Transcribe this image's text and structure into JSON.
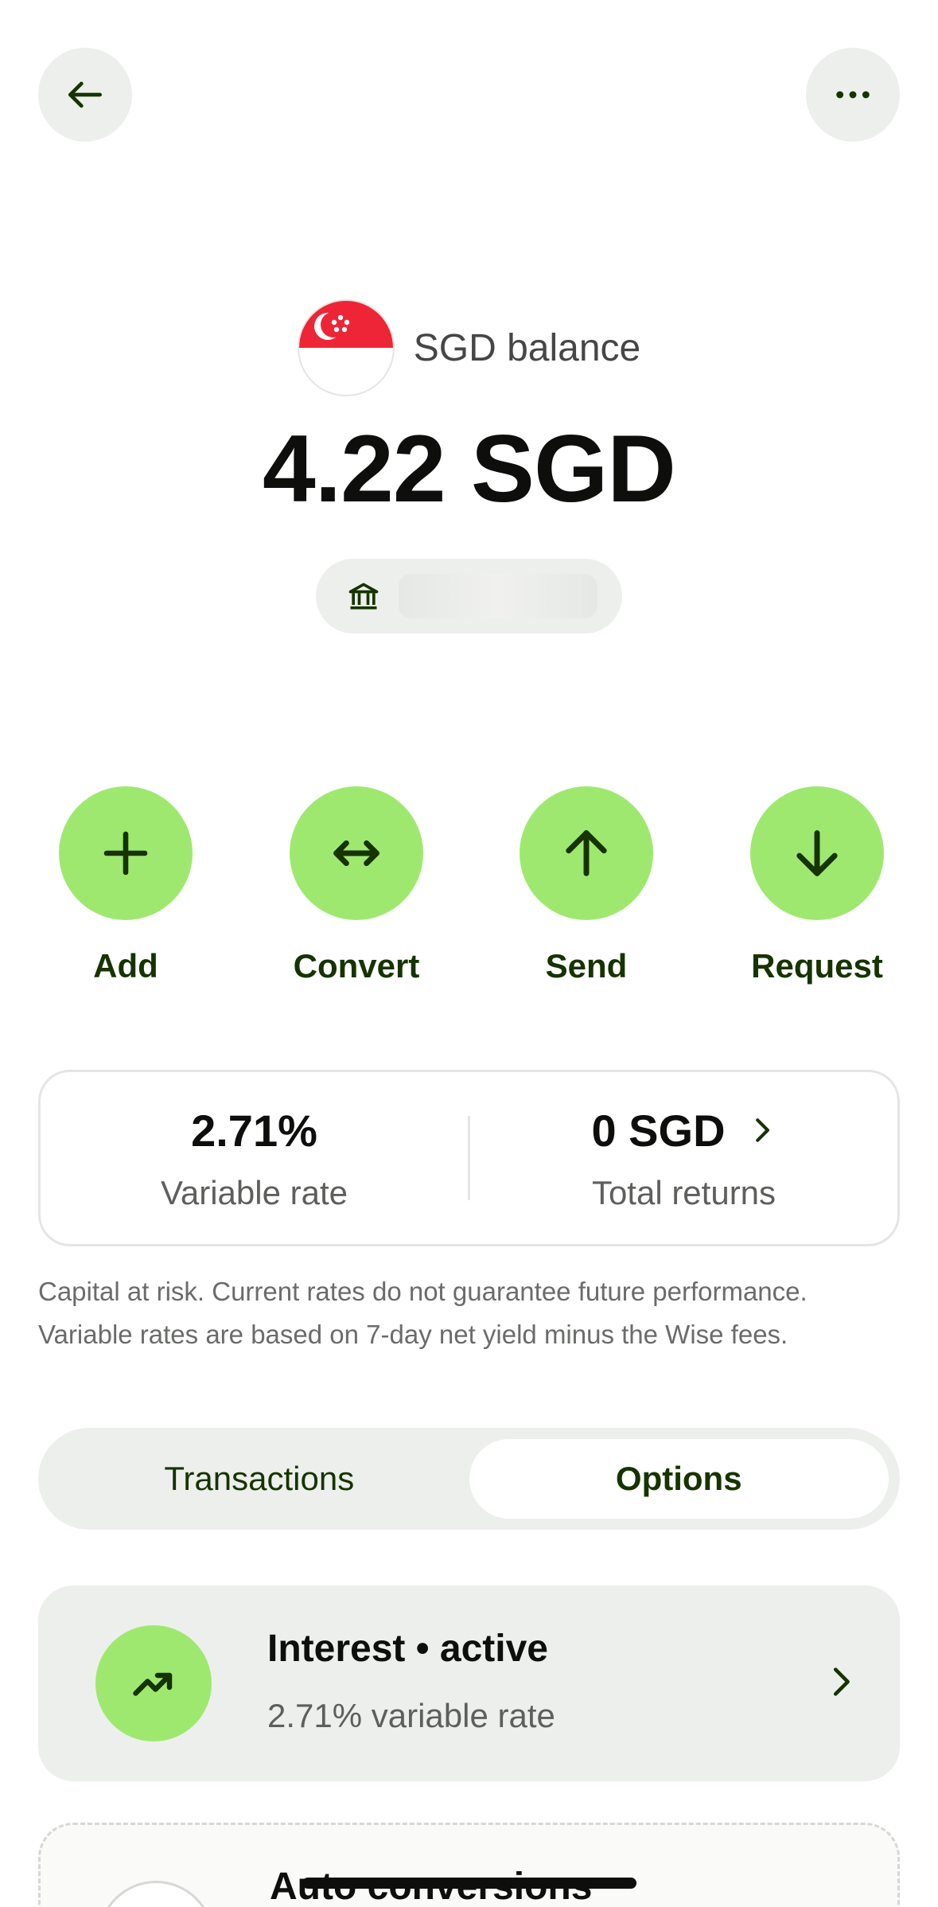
{
  "header": {
    "back_icon": "arrow-left-icon",
    "more_icon": "more-horizontal-icon"
  },
  "balance": {
    "label": "SGD balance",
    "amount": "4.22 SGD",
    "flag": "singapore-flag",
    "bank_icon": "bank-icon"
  },
  "actions": [
    {
      "label": "Add",
      "icon": "plus-icon"
    },
    {
      "label": "Convert",
      "icon": "convert-arrows-icon"
    },
    {
      "label": "Send",
      "icon": "arrow-up-icon"
    },
    {
      "label": "Request",
      "icon": "arrow-down-icon"
    }
  ],
  "stats": {
    "rate_value": "2.71%",
    "rate_label": "Variable rate",
    "returns_value": "0 SGD",
    "returns_label": "Total returns"
  },
  "disclaimer": {
    "line1": "Capital at risk. Current rates do not guarantee future performance.",
    "line2": "Variable rates are based on 7-day net yield minus the Wise fees."
  },
  "tabs": [
    {
      "label": "Transactions",
      "active": false
    },
    {
      "label": "Options",
      "active": true
    }
  ],
  "options": [
    {
      "title": "Interest • active",
      "subtitle": "2.71% variable rate",
      "icon": "trending-up-icon"
    },
    {
      "title": "Auto conversions"
    }
  ],
  "colors": {
    "accent_green": "#9fe870",
    "dark_green": "#163300",
    "surface_grey": "#edefec",
    "flag_red": "#ee2536"
  }
}
